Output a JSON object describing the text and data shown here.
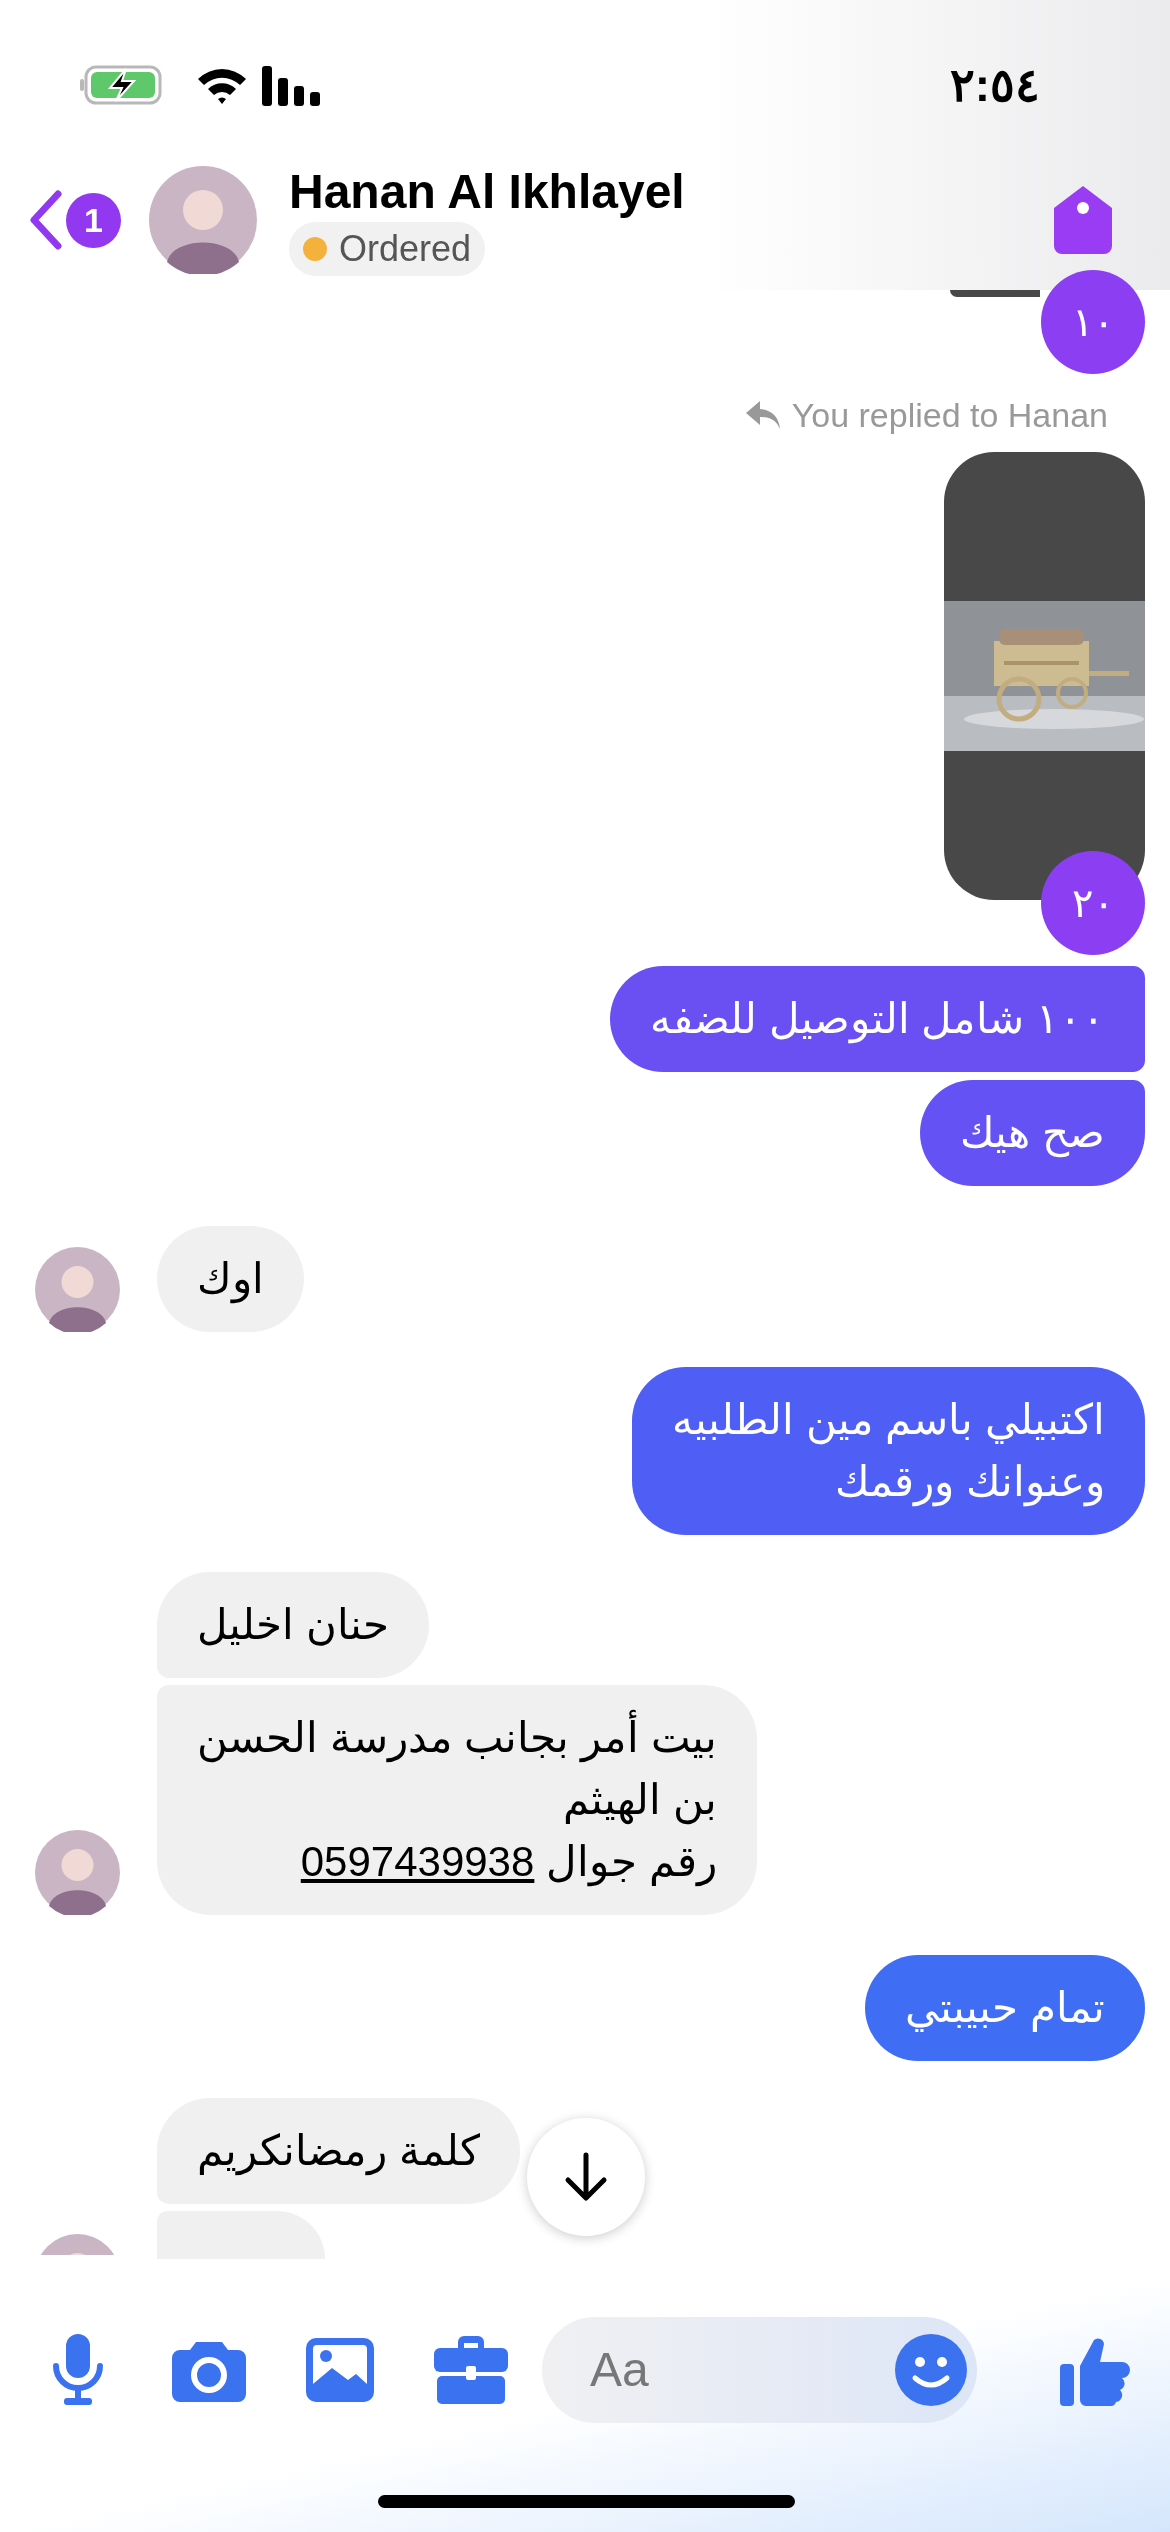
{
  "status_bar": {
    "time": "٢:٥٤"
  },
  "header": {
    "back_count": "1",
    "name": "Hanan Al Ikhlayel",
    "status": "Ordered"
  },
  "messages": [
    {
      "kind": "image_end",
      "reaction": "١٠"
    },
    {
      "kind": "reply_note",
      "text": "You replied to Hanan"
    },
    {
      "reaction": "٢٠"
    },
    {
      "kind": "sent",
      "lines": [
        "١٠٠ شامل التوصيل للضفه"
      ]
    },
    {
      "kind": "sent",
      "lines": [
        "صح هيك"
      ]
    },
    {
      "kind": "received",
      "lines": [
        "اوك"
      ]
    },
    {
      "kind": "sent",
      "lines": [
        "اكتبيلي باسم مين الطلبيه",
        "وعنوانك ورقمك"
      ]
    },
    {
      "kind": "received",
      "lines": [
        "حنان اخليل"
      ]
    },
    {
      "kind": "received",
      "lines": [
        "بيت أمر بجانب مدرسة الحسن",
        "بن الهيثم"
      ],
      "phone_label": "رقم جوال",
      "phone": "0597439938"
    },
    {
      "kind": "sent",
      "lines": [
        "تمام حبيبتي"
      ]
    },
    {
      "kind": "received",
      "lines": [
        "كلمة رمضانكريم"
      ]
    },
    {
      "kind": "received_cut"
    }
  ],
  "composer": {
    "placeholder": "Aa"
  }
}
